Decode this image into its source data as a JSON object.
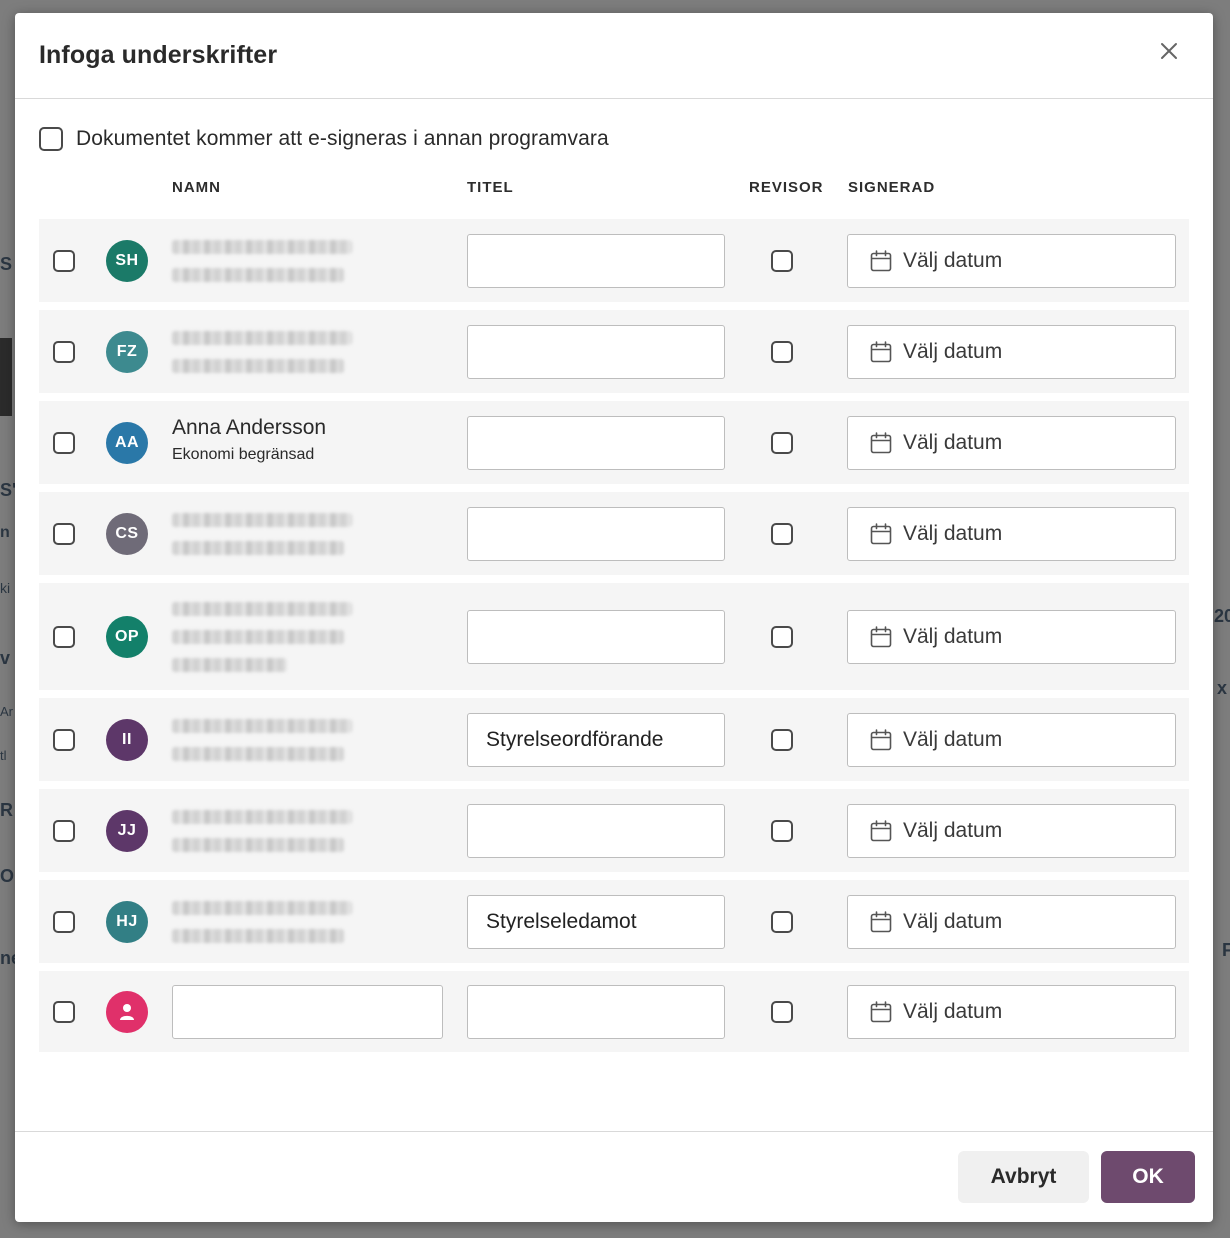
{
  "background": {
    "fragments": [
      "S",
      "S'",
      "n",
      "ki",
      "v",
      "Ar",
      "tl",
      "R",
      "O",
      "ne",
      "20",
      "x",
      "F"
    ]
  },
  "dialog": {
    "title": "Infoga underskrifter",
    "close_icon": "close-icon",
    "esign_label": "Dokumentet kommer att e-signeras i annan programvara",
    "esign_checked": false
  },
  "columns": {
    "namn": "NAMN",
    "titel": "TITEL",
    "revisor": "REVISOR",
    "signerad": "SIGNERAD"
  },
  "rows": [
    {
      "initials": "SH",
      "avatar_color": "#1b7a68",
      "name": "",
      "subtitle": "",
      "redacted": true,
      "redacted_lines": 2,
      "titel": "",
      "date_placeholder": "Välj datum",
      "checked": false,
      "revisor": false
    },
    {
      "initials": "FZ",
      "avatar_color": "#3d8a8f",
      "name": "",
      "subtitle": "",
      "redacted": true,
      "redacted_lines": 2,
      "titel": "",
      "date_placeholder": "Välj datum",
      "checked": false,
      "revisor": false
    },
    {
      "initials": "AA",
      "avatar_color": "#2a78a8",
      "name": "Anna Andersson",
      "subtitle": "Ekonomi begränsad",
      "redacted": false,
      "redacted_lines": 0,
      "titel": "",
      "date_placeholder": "Välj datum",
      "checked": false,
      "revisor": false
    },
    {
      "initials": "CS",
      "avatar_color": "#6f6b78",
      "name": "",
      "subtitle": "",
      "redacted": true,
      "redacted_lines": 2,
      "titel": "",
      "date_placeholder": "Välj datum",
      "checked": false,
      "revisor": false
    },
    {
      "initials": "OP",
      "avatar_color": "#13806a",
      "name": "",
      "subtitle": "",
      "redacted": true,
      "redacted_lines": 3,
      "titel": "",
      "date_placeholder": "Välj datum",
      "checked": false,
      "revisor": false
    },
    {
      "initials": "II",
      "avatar_color": "#5d3769",
      "name": "",
      "subtitle": "",
      "redacted": true,
      "redacted_lines": 2,
      "titel": "Styrelseordförande",
      "date_placeholder": "Välj datum",
      "checked": false,
      "revisor": false
    },
    {
      "initials": "JJ",
      "avatar_color": "#5d3769",
      "name": "",
      "subtitle": "",
      "redacted": true,
      "redacted_lines": 2,
      "titel": "",
      "date_placeholder": "Välj datum",
      "checked": false,
      "revisor": false
    },
    {
      "initials": "HJ",
      "avatar_color": "#327f85",
      "name": "",
      "subtitle": "",
      "redacted": true,
      "redacted_lines": 2,
      "titel": "Styrelseledamot",
      "date_placeholder": "Välj datum",
      "checked": false,
      "revisor": false
    },
    {
      "initials": "",
      "avatar_color": "#e0306a",
      "avatar_icon": "person-icon",
      "name": "",
      "subtitle": "",
      "redacted": false,
      "redacted_lines": 0,
      "editable_name": true,
      "titel": "",
      "date_placeholder": "Välj datum",
      "checked": false,
      "revisor": false
    }
  ],
  "footer": {
    "cancel_label": "Avbryt",
    "ok_label": "OK"
  },
  "colors": {
    "primary": "#6e4a6e",
    "row_bg": "#f5f5f5",
    "overlay": "#7d7d7d"
  }
}
